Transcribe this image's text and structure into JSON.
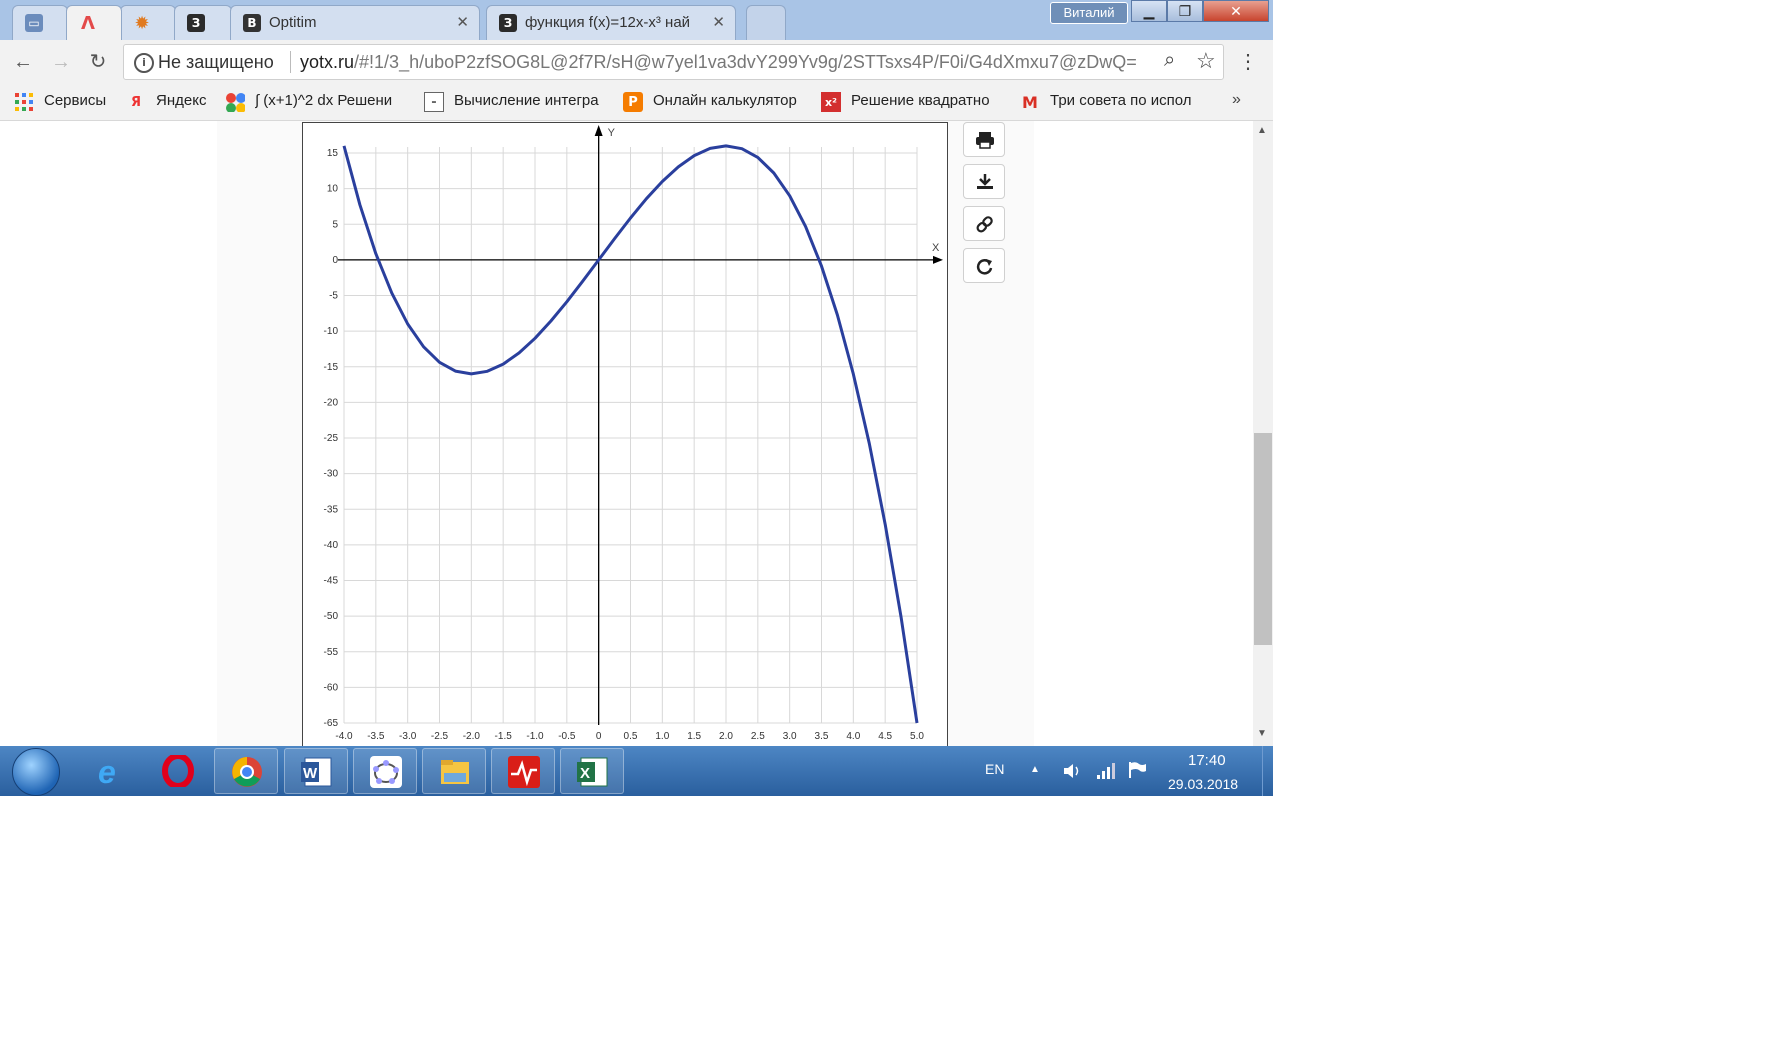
{
  "tabs": [
    {
      "title": "",
      "fav": "window-icon",
      "color": "#6b8cbc"
    },
    {
      "title": "",
      "fav": "lambda-icon",
      "color": "#e34a4a",
      "active": true
    },
    {
      "title": "",
      "fav": "gear-icon",
      "color": "#e07a20"
    },
    {
      "title": "",
      "fav": "З",
      "color": "#2b2b2b"
    },
    {
      "title": "Optitim",
      "fav": "B",
      "color": "#333333"
    },
    {
      "title": "функция f(x)=12x-x³ най",
      "fav": "З",
      "color": "#2b2b2b"
    }
  ],
  "window": {
    "user": "Виталий"
  },
  "toolbar": {
    "security_label": "Не защищено",
    "url_host": "yotx.ru",
    "url_path": "/#!1/3_h/uboP2zfSOG8L@2f7R/sH@w7yel1va3dvY299Yv9g/2STTsxs4P/F0i/G4dXmxu7@zDwQ="
  },
  "bookmarks": [
    {
      "label": "Сервисы",
      "icon": "apps-grid-icon",
      "color": "#4285f4"
    },
    {
      "label": "Яндекс",
      "icon": "Я",
      "color": "#e33"
    },
    {
      "label": "∫ (x+1)^2 dx Решени",
      "icon": "dots-icon",
      "color": "#f4b400"
    },
    {
      "label": "Вычисление интегра",
      "icon": "page-icon",
      "color": "#666"
    },
    {
      "label": "Онлайн калькулятор",
      "icon": "P",
      "color": "#f57c00"
    },
    {
      "label": "Решение квадратно",
      "icon": "x²",
      "color": "#d32f2f"
    },
    {
      "label": "Три совета по испол",
      "icon": "M",
      "color": "#d93025"
    }
  ],
  "bookmarks_more": "»",
  "chart_data": {
    "type": "line",
    "function": "f(x)=12x-x^3",
    "xlabel": "X",
    "ylabel": "Y",
    "xlim": [
      -4.0,
      5.0
    ],
    "ylim": [
      -65,
      15
    ],
    "x_ticks": [
      "-4.0",
      "-3.5",
      "-3.0",
      "-2.5",
      "-2.0",
      "-1.5",
      "-1.0",
      "-0.5",
      "0",
      "0.5",
      "1.0",
      "1.5",
      "2.0",
      "2.5",
      "3.0",
      "3.5",
      "4.0",
      "4.5",
      "5.0"
    ],
    "y_ticks": [
      "15",
      "10",
      "5",
      "0",
      "-5",
      "-10",
      "-15",
      "-20",
      "-25",
      "-30",
      "-35",
      "-40",
      "-45",
      "-50",
      "-55",
      "-60",
      "-65"
    ],
    "grid": true,
    "series": [
      {
        "color": "#2a3f9d",
        "x": [
          -4.0,
          -3.75,
          -3.5,
          -3.25,
          -3.0,
          -2.75,
          -2.5,
          -2.25,
          -2.0,
          -1.75,
          -1.5,
          -1.25,
          -1.0,
          -0.75,
          -0.5,
          -0.25,
          0,
          0.25,
          0.5,
          0.75,
          1.0,
          1.25,
          1.5,
          1.75,
          2.0,
          2.25,
          2.5,
          2.75,
          3.0,
          3.25,
          3.5,
          3.75,
          4.0,
          4.25,
          4.5,
          4.75,
          5.0
        ],
        "y": [
          16,
          7.73,
          0.88,
          -4.67,
          -9,
          -12.2,
          -14.38,
          -15.61,
          -16,
          -15.64,
          -14.63,
          -13.05,
          -11,
          -8.58,
          -5.88,
          -2.98,
          0,
          2.98,
          5.88,
          8.58,
          11,
          13.05,
          14.63,
          15.64,
          16,
          15.61,
          14.38,
          12.2,
          9,
          4.67,
          -0.88,
          -7.73,
          -16,
          -25.77,
          -37.13,
          -50.17,
          -65
        ]
      }
    ]
  },
  "side_buttons": [
    "print-icon",
    "download-icon",
    "link-icon",
    "share-icon"
  ],
  "taskbar": {
    "apps": [
      "ie-icon",
      "opera-icon",
      "chrome-icon",
      "word-icon",
      "geogebra-icon",
      "explorer-icon",
      "media-icon",
      "excel-icon"
    ],
    "language": "EN",
    "time": "17:40",
    "date": "29.03.2018"
  }
}
